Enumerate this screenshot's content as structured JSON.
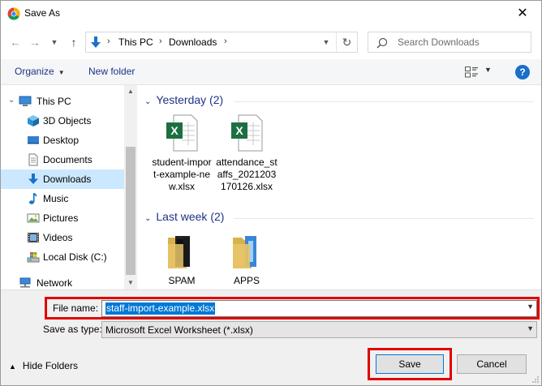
{
  "window": {
    "title": "Save As",
    "close_glyph": "✕"
  },
  "nav": {
    "back_glyph": "←",
    "forward_glyph": "→",
    "up_glyph": "↑",
    "breadcrumb": [
      "This PC",
      "Downloads"
    ],
    "search_placeholder": "Search Downloads"
  },
  "toolbar": {
    "organize_label": "Organize",
    "new_folder_label": "New folder",
    "help_label": "?"
  },
  "sidebar": {
    "items": [
      {
        "label": "This PC",
        "icon": "computer-icon"
      },
      {
        "label": "3D Objects",
        "icon": "cube-icon"
      },
      {
        "label": "Desktop",
        "icon": "desktop-icon"
      },
      {
        "label": "Documents",
        "icon": "document-icon"
      },
      {
        "label": "Downloads",
        "icon": "download-arrow-icon",
        "selected": true
      },
      {
        "label": "Music",
        "icon": "music-note-icon"
      },
      {
        "label": "Pictures",
        "icon": "picture-icon"
      },
      {
        "label": "Videos",
        "icon": "film-icon"
      },
      {
        "label": "Local Disk (C:)",
        "icon": "drive-icon"
      },
      {
        "label": "Network",
        "icon": "network-icon"
      }
    ]
  },
  "groups": [
    {
      "title": "Yesterday (2)",
      "files": [
        {
          "name": "student-import-example-new.xlsx",
          "icon": "excel-file-icon"
        },
        {
          "name": "attendance_staffs_2021203170126.xlsx",
          "icon": "excel-file-icon"
        }
      ]
    },
    {
      "title": "Last week (2)",
      "files": [
        {
          "name": "SPAM",
          "icon": "folder-icon"
        },
        {
          "name": "APPS",
          "icon": "folder-icon"
        }
      ]
    }
  ],
  "form": {
    "file_name_label": "File name:",
    "file_name_value": "staff-import-example.xlsx",
    "save_as_type_label": "Save as type:",
    "save_as_type_value": "Microsoft Excel Worksheet (*.xlsx)"
  },
  "footer": {
    "hide_folders_label": "Hide Folders",
    "save_label": "Save",
    "cancel_label": "Cancel"
  },
  "colors": {
    "accent": "#0078d7",
    "highlight_outline": "#e00000",
    "link_blue": "#1e3287",
    "selected_bg": "#cce8ff",
    "excel_green": "#1d6f42",
    "folder_yellow": "#e8c468"
  }
}
